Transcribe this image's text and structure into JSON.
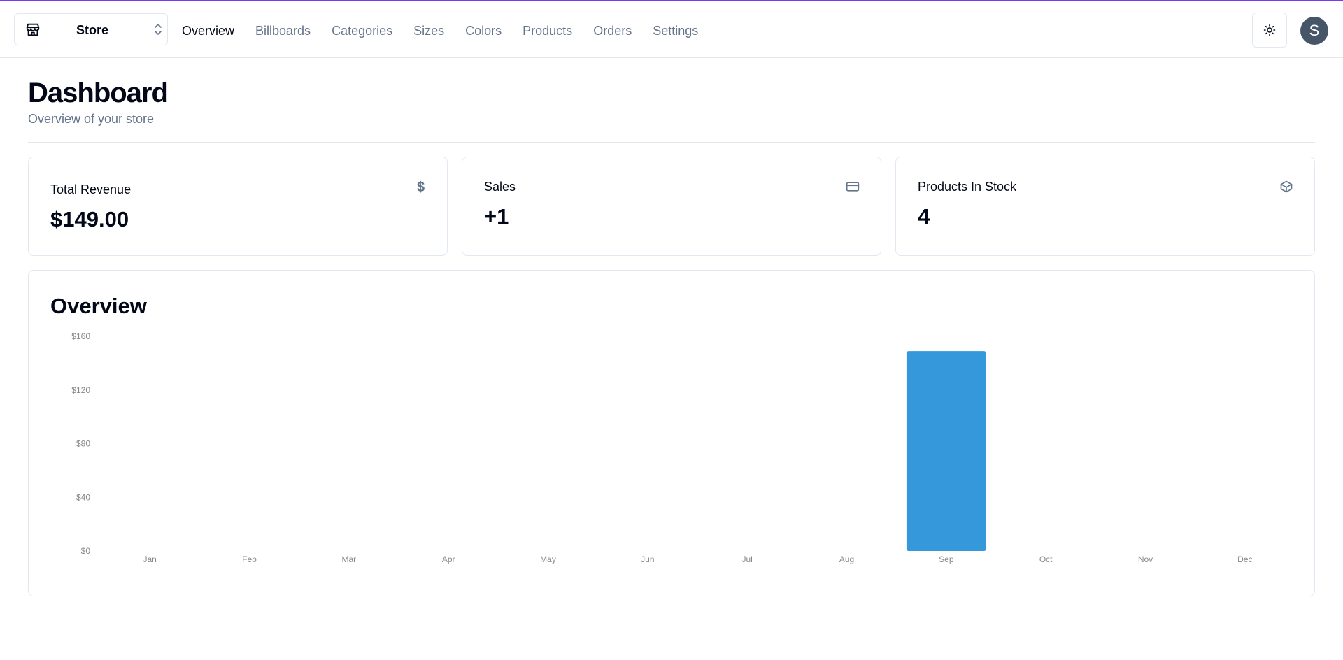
{
  "nav": {
    "store_name": "Store",
    "links": [
      "Overview",
      "Billboards",
      "Categories",
      "Sizes",
      "Colors",
      "Products",
      "Orders",
      "Settings"
    ],
    "active": "Overview",
    "avatar_initial": "S"
  },
  "header": {
    "title": "Dashboard",
    "subtitle": "Overview of your store"
  },
  "cards": {
    "revenue": {
      "label": "Total Revenue",
      "value": "$149.00",
      "icon": "dollar-icon"
    },
    "sales": {
      "label": "Sales",
      "value": "+1",
      "icon": "credit-card-icon"
    },
    "stock": {
      "label": "Products In Stock",
      "value": "4",
      "icon": "package-icon"
    }
  },
  "overview": {
    "title": "Overview"
  },
  "colors": {
    "bar": "#3498db",
    "accent_line": "#7c3aed"
  },
  "chart_data": {
    "type": "bar",
    "title": "Overview",
    "categories": [
      "Jan",
      "Feb",
      "Mar",
      "Apr",
      "May",
      "Jun",
      "Jul",
      "Aug",
      "Sep",
      "Oct",
      "Nov",
      "Dec"
    ],
    "values": [
      0,
      0,
      0,
      0,
      0,
      0,
      0,
      0,
      149,
      0,
      0,
      0
    ],
    "yticks": [
      "$0",
      "$40",
      "$80",
      "$120",
      "$160"
    ],
    "ylim": [
      0,
      160
    ],
    "xlabel": "",
    "ylabel": "",
    "grid": false
  }
}
